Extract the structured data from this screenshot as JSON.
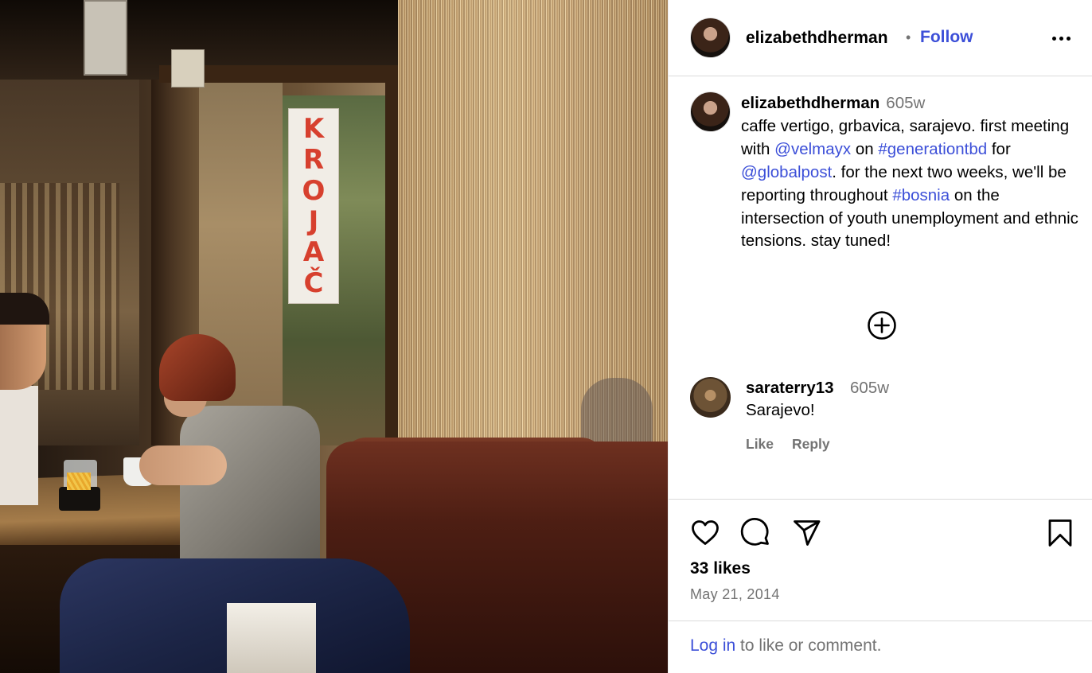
{
  "photo": {
    "sign_letters": [
      "K",
      "R",
      "O",
      "J",
      "A",
      "Č"
    ]
  },
  "header": {
    "username": "elizabethdherman",
    "separator": "•",
    "follow_label": "Follow"
  },
  "caption": {
    "username": "elizabethdherman",
    "time": "605w",
    "segments": [
      {
        "text": "caffe vertigo, grbavica, sarajevo. first meeting with ",
        "link": false
      },
      {
        "text": "@velmayx",
        "link": true
      },
      {
        "text": " on ",
        "link": false
      },
      {
        "text": "#generationtbd",
        "link": true
      },
      {
        "text": " for ",
        "link": false
      },
      {
        "text": "@globalpost",
        "link": true
      },
      {
        "text": ". for the next two weeks, we'll be reporting throughout ",
        "link": false
      },
      {
        "text": "#bosnia",
        "link": true
      },
      {
        "text": " on the intersection of youth unemployment and ethnic tensions. stay tuned!",
        "link": false
      }
    ]
  },
  "comment": {
    "username": "saraterry13",
    "time": "605w",
    "text": "Sarajevo!",
    "like_label": "Like",
    "reply_label": "Reply"
  },
  "actions": {
    "likes": "33 likes",
    "date": "May 21, 2014"
  },
  "login": {
    "link_text": "Log in",
    "rest_text": " to like or comment."
  },
  "colors": {
    "link": "#3c4fd8",
    "muted": "#737373",
    "divider": "#dbdbdb",
    "sign_text": "#d7402e"
  },
  "icons": [
    "more-horizontal-icon",
    "load-more-comments-icon",
    "heart-icon",
    "comment-icon",
    "share-icon",
    "bookmark-icon"
  ]
}
